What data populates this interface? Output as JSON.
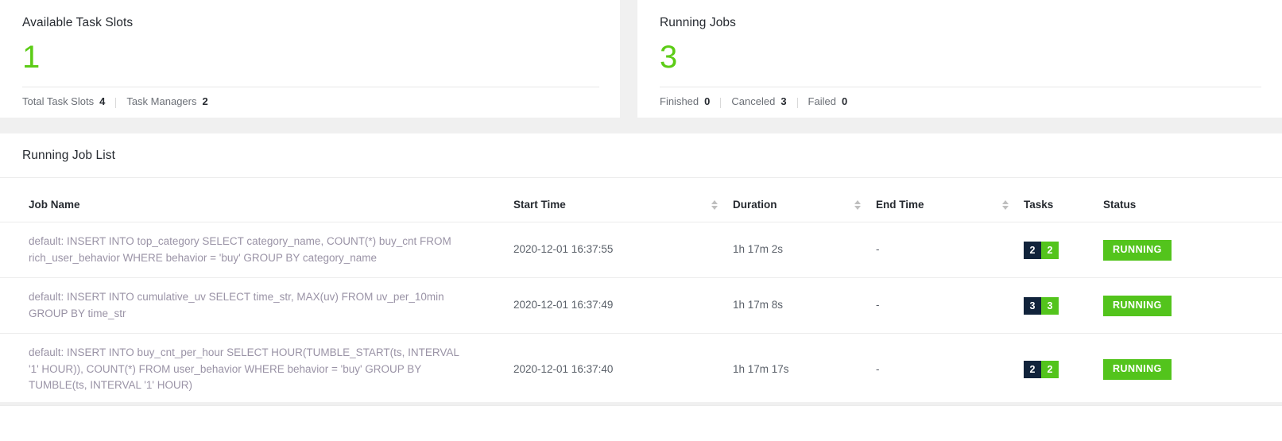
{
  "metrics": [
    {
      "title": "Available Task Slots",
      "value": "1",
      "value_color": "#5ccc16",
      "footer": [
        {
          "label": "Total Task Slots",
          "value": "4"
        },
        {
          "label": "Task Managers",
          "value": "2"
        }
      ]
    },
    {
      "title": "Running Jobs",
      "value": "3",
      "value_color": "#5ccc16",
      "footer": [
        {
          "label": "Finished",
          "value": "0"
        },
        {
          "label": "Canceled",
          "value": "3"
        },
        {
          "label": "Failed",
          "value": "0"
        }
      ]
    }
  ],
  "job_list": {
    "panel_title": "Running Job List",
    "columns": [
      {
        "label": "Job Name",
        "sortable": false
      },
      {
        "label": "Start Time",
        "sortable": true
      },
      {
        "label": "Duration",
        "sortable": true
      },
      {
        "label": "End Time",
        "sortable": true
      },
      {
        "label": "Tasks",
        "sortable": true
      },
      {
        "label": "Status",
        "sortable": true
      }
    ],
    "rows": [
      {
        "job_name": "default: INSERT INTO top_category SELECT category_name, COUNT(*) buy_cnt FROM rich_user_behavior WHERE behavior = 'buy' GROUP BY category_name",
        "start_time": "2020-12-01 16:37:55",
        "duration": "1h 17m 2s",
        "end_time": "-",
        "tasks_total": "2",
        "tasks_running": "2",
        "status": "RUNNING"
      },
      {
        "job_name": "default: INSERT INTO cumulative_uv SELECT time_str, MAX(uv) FROM uv_per_10min GROUP BY time_str",
        "start_time": "2020-12-01 16:37:49",
        "duration": "1h 17m 8s",
        "end_time": "-",
        "tasks_total": "3",
        "tasks_running": "3",
        "status": "RUNNING"
      },
      {
        "job_name": "default: INSERT INTO buy_cnt_per_hour SELECT HOUR(TUMBLE_START(ts, INTERVAL '1' HOUR)), COUNT(*) FROM user_behavior WHERE behavior = 'buy' GROUP BY TUMBLE(ts, INTERVAL '1' HOUR)",
        "start_time": "2020-12-01 16:37:40",
        "duration": "1h 17m 17s",
        "end_time": "-",
        "tasks_total": "2",
        "tasks_running": "2",
        "status": "RUNNING"
      }
    ]
  },
  "colors": {
    "accent_green": "#53c41c",
    "task_total_navy": "#11233b",
    "page_background": "#f0f0f0",
    "card_background": "#ffffff"
  }
}
